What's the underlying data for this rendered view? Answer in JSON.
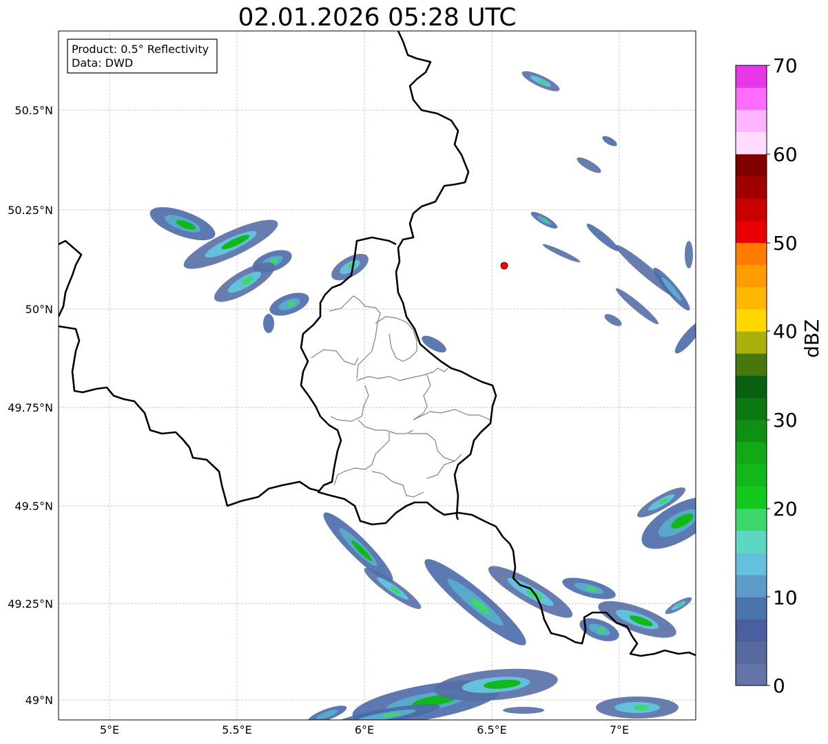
{
  "title": "02.01.2026 05:28 UTC",
  "info_box": {
    "product": "Product: 0.5° Reflectivity",
    "data": "Data: DWD"
  },
  "axes": {
    "lon_ticks": [
      "5°E",
      "5.5°E",
      "6°E",
      "6.5°E",
      "7°E"
    ],
    "lat_ticks": [
      "50.5°N",
      "50.25°N",
      "50°N",
      "49.75°N",
      "49.5°N",
      "49.25°N",
      "49°N"
    ],
    "lon_range": [
      4.8,
      7.3
    ],
    "lat_range": [
      48.95,
      50.7
    ]
  },
  "colorbar": {
    "label": "dBZ",
    "ticks": [
      "0",
      "10",
      "20",
      "30",
      "40",
      "50",
      "60",
      "70"
    ],
    "range": [
      0,
      70
    ],
    "colors": [
      "#6474a6",
      "#566a9e",
      "#4b5ea0",
      "#4a74ab",
      "#5c9cc6",
      "#64c1dc",
      "#5ed6c4",
      "#3cd86c",
      "#12c81c",
      "#12b81a",
      "#12a816",
      "#0f9014",
      "#0c7812",
      "#086010",
      "#48780c",
      "#aab10a",
      "#ffd800",
      "#ffb800",
      "#ff9c00",
      "#ff7c00",
      "#e60000",
      "#c80000",
      "#a00000",
      "#800000",
      "#ffdcff",
      "#ffb4ff",
      "#ff6cff",
      "#e836e8"
    ]
  },
  "radar_site": {
    "lon": 6.55,
    "lat": 50.11,
    "color": "#ff0000"
  }
}
